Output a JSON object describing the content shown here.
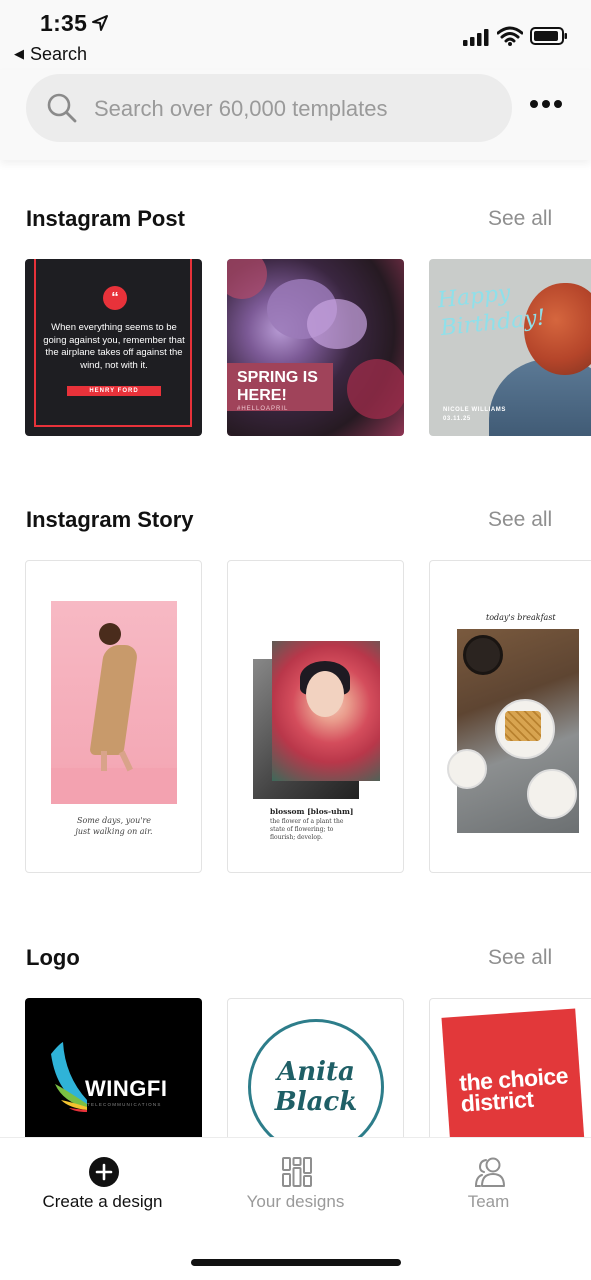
{
  "status_bar": {
    "time": "1:35",
    "back_app_label": "Search"
  },
  "search": {
    "placeholder": "Search over 60,000 templates"
  },
  "sections": [
    {
      "title": "Instagram Post",
      "see_all": "See all",
      "templates": [
        {
          "quote": "When everything seems to be going against you, remember that the airplane takes off against the wind, not with it.",
          "author": "HENRY FORD",
          "quote_mark": "“"
        },
        {
          "headline": "SPRING IS HERE!",
          "hashtag": "#HELLOAPRIL"
        },
        {
          "headline": "Happy Birthday!",
          "name": "NICOLE WILLIAMS",
          "date": "03.11.25"
        }
      ]
    },
    {
      "title": "Instagram Story",
      "see_all": "See all",
      "templates": [
        {
          "caption": "Some days, you're just walking on air."
        },
        {
          "word": "blossom [blos-uhm]",
          "definition": "the flower of a plant the state of flowering; to flourish; develop."
        },
        {
          "caption": "today's breakfast"
        }
      ]
    },
    {
      "title": "Logo",
      "see_all": "See all",
      "templates": [
        {
          "name": "WINGFI",
          "subtitle": "TELECOMMUNICATIONS"
        },
        {
          "name": "Anita Black"
        },
        {
          "name": "the choice district"
        }
      ]
    }
  ],
  "bottom_nav": {
    "items": [
      {
        "label": "Create a design",
        "icon": "plus-circle-icon",
        "active": true
      },
      {
        "label": "Your designs",
        "icon": "grid-icon",
        "active": false
      },
      {
        "label": "Team",
        "icon": "team-icon",
        "active": false
      }
    ]
  },
  "colors": {
    "accent_red": "#e8323a",
    "inactive": "#9a9a9a",
    "active": "#111111"
  }
}
